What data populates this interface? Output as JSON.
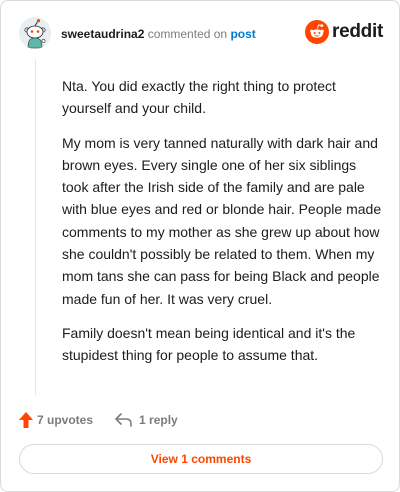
{
  "header": {
    "username": "sweetaudrina2",
    "action_text": "commented on",
    "post_link": "post",
    "brand_name": "reddit",
    "brand_color": "#ff4500"
  },
  "comment": {
    "paragraphs": [
      "Nta. You did exactly the right thing to protect yourself and your child.",
      "My mom is very tanned naturally with dark hair and brown eyes. Every single one of her six siblings took after the Irish side of the family and are pale with blue eyes and red or blonde hair. People made comments to my mother as she grew up about how she couldn't possibly be related to them. When my mom tans she can pass for being Black and people made fun of her. It was very cruel.",
      "Family doesn't mean being identical and it's the stupidest thing for people to assume that."
    ]
  },
  "actions": {
    "upvotes_label": "7 upvotes",
    "reply_label": "1 reply",
    "upvote_icon": "upvote-arrow-icon",
    "reply_icon": "reply-arrow-icon"
  },
  "footer": {
    "view_comments_label": "View 1 comments"
  },
  "colors": {
    "accent": "#ff4500",
    "link": "#0079d3",
    "muted": "#7c7c7c",
    "border": "#d8dadc"
  }
}
